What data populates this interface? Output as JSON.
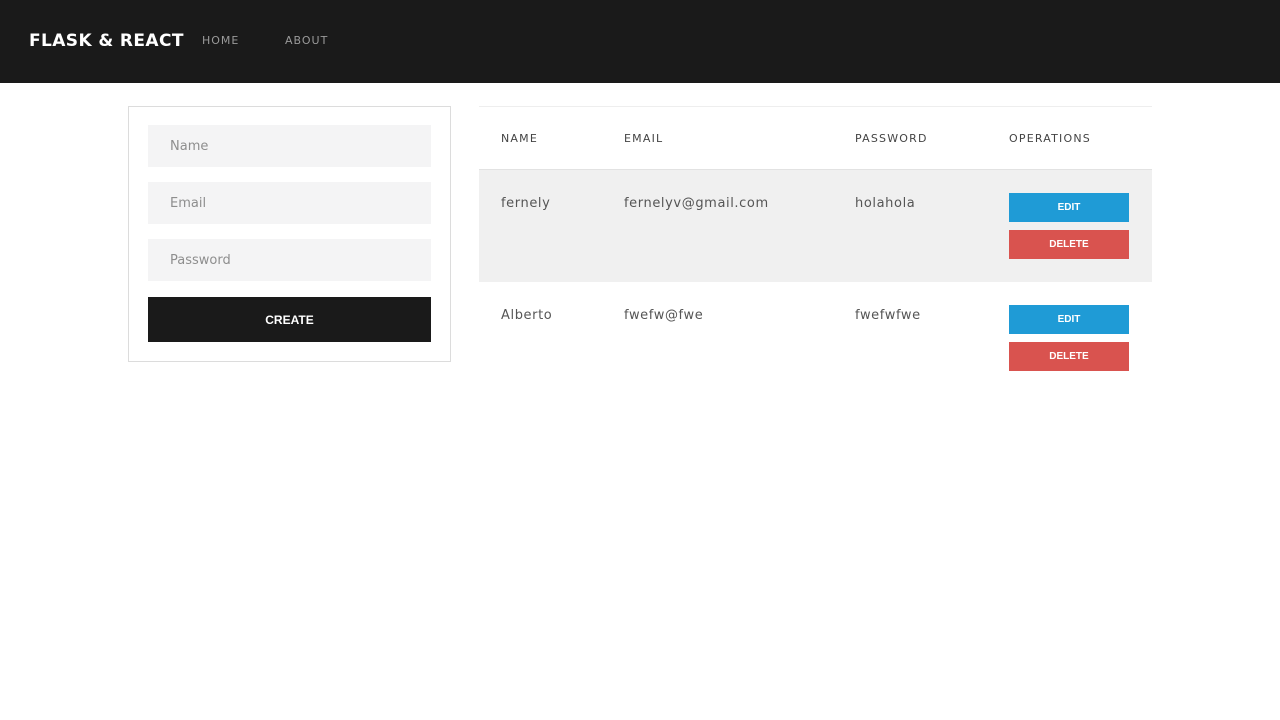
{
  "navbar": {
    "brand": "FLASK & REACT",
    "links": [
      "HOME",
      "ABOUT"
    ]
  },
  "form": {
    "name_placeholder": "Name",
    "email_placeholder": "Email",
    "password_placeholder": "Password",
    "create_label": "CREATE"
  },
  "table": {
    "headers": [
      "NAME",
      "EMAIL",
      "PASSWORD",
      "OPERATIONS"
    ],
    "rows": [
      {
        "name": "fernely",
        "email": "fernelyv@gmail.com",
        "password": "holahola",
        "edit_label": "EDIT",
        "delete_label": "DELETE"
      },
      {
        "name": "Alberto",
        "email": "fwefw@fwe",
        "password": "fwefwfwe",
        "edit_label": "EDIT",
        "delete_label": "DELETE"
      }
    ]
  },
  "colors": {
    "navbar_bg": "#1a1a1a",
    "edit_button": "#1f9bd6",
    "delete_button": "#d9534f",
    "highlighted_row": "#f0f0f0"
  }
}
